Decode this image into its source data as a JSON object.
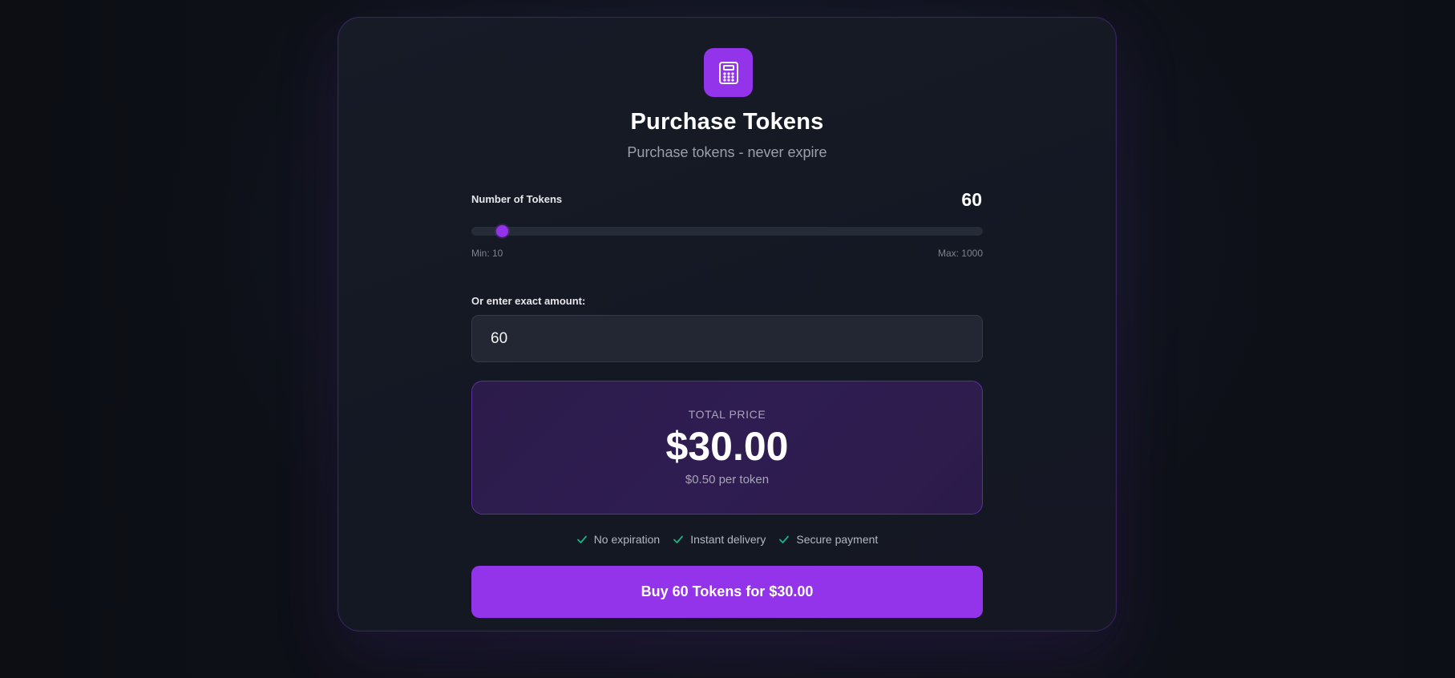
{
  "header": {
    "icon": "calculator-icon",
    "title": "Purchase Tokens",
    "subtitle": "Purchase tokens - never expire"
  },
  "slider": {
    "label": "Number of Tokens",
    "value": 60,
    "value_display": "60",
    "min": 10,
    "max": 1000,
    "min_label": "Min: 10",
    "max_label": "Max: 1000"
  },
  "exact": {
    "label": "Or enter exact amount:",
    "value": "60"
  },
  "price": {
    "caption": "TOTAL PRICE",
    "amount": "$30.00",
    "per_token": "$0.50 per token"
  },
  "features": [
    {
      "icon": "check-icon",
      "label": "No expiration"
    },
    {
      "icon": "check-icon",
      "label": "Instant delivery"
    },
    {
      "icon": "check-icon",
      "label": "Secure payment"
    }
  ],
  "buy_button": {
    "label": "Buy 60 Tokens for $30.00"
  },
  "colors": {
    "accent": "#9333ea",
    "check": "#10b981",
    "background": "#0f1118",
    "card": "#161a25"
  }
}
